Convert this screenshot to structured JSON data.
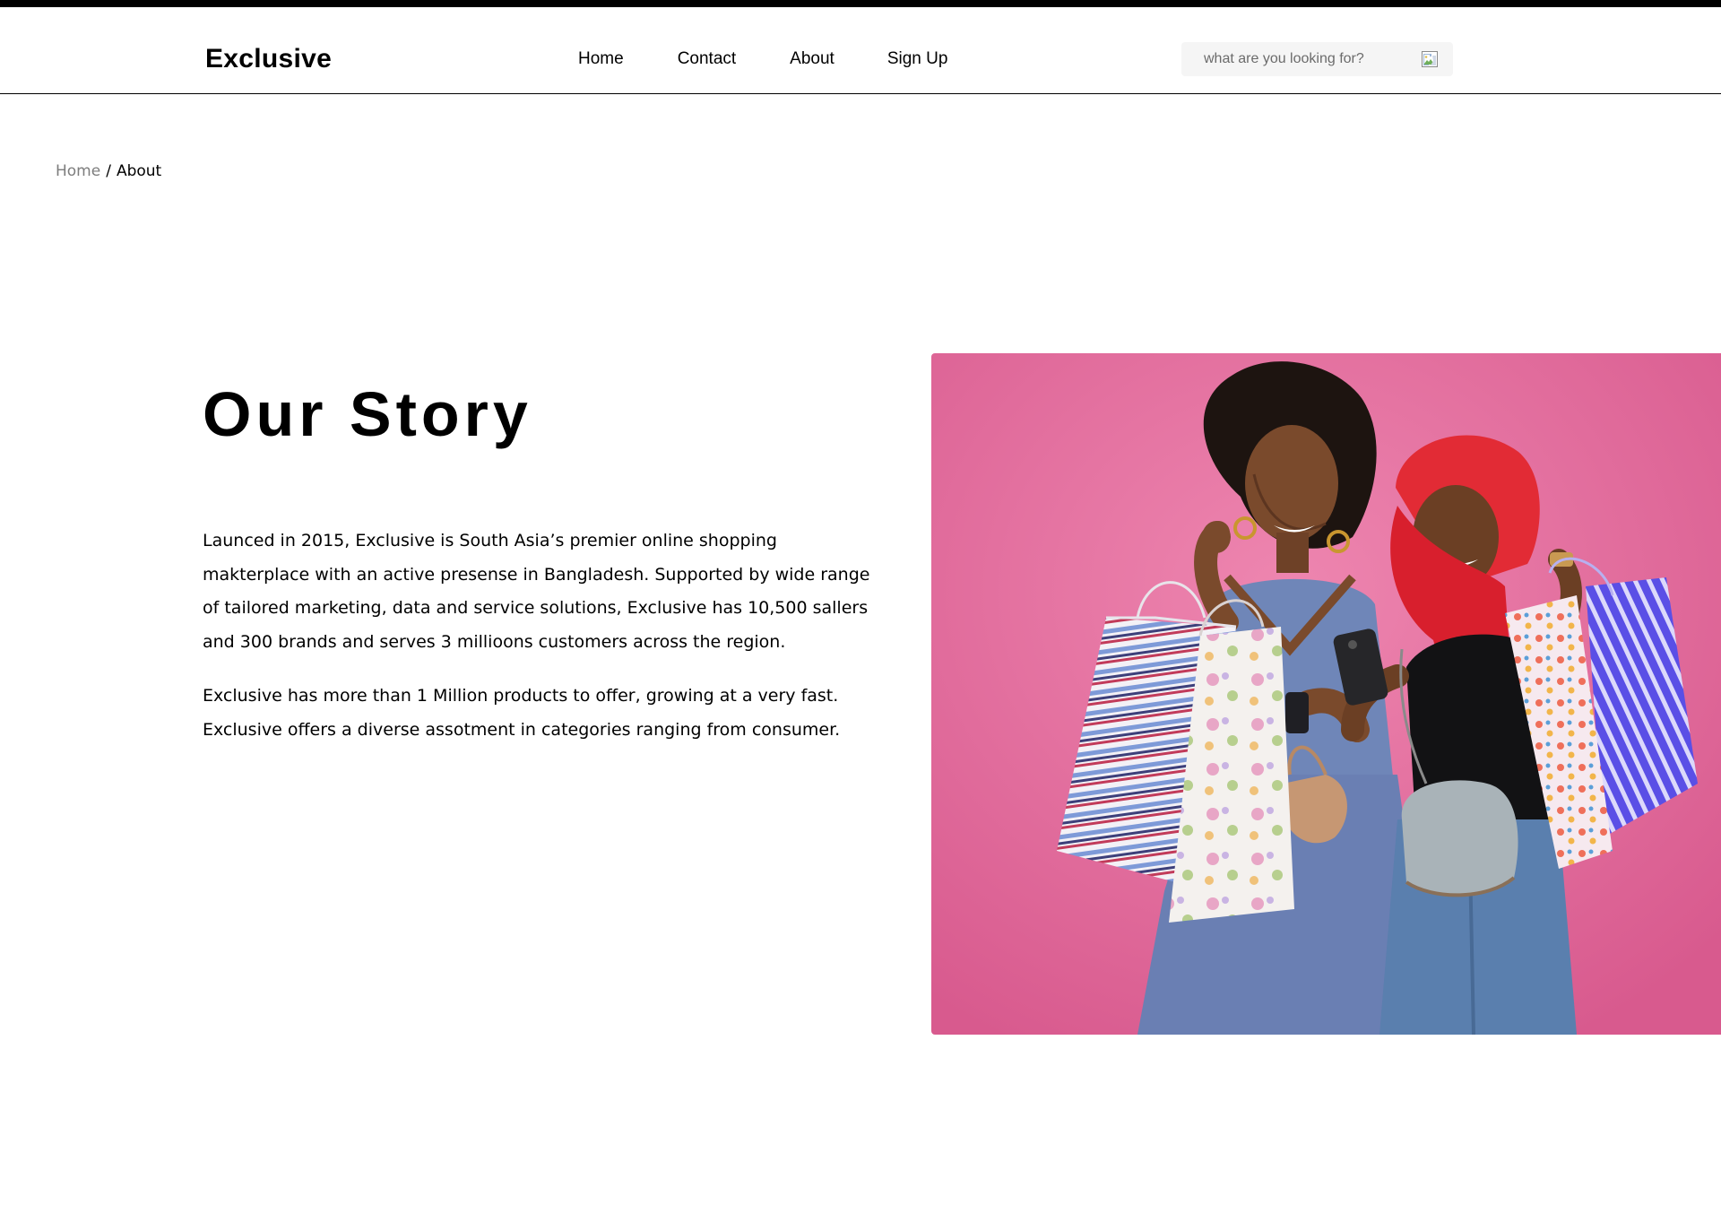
{
  "header": {
    "logo": "Exclusive",
    "nav": {
      "home": "Home",
      "contact": "Contact",
      "about": "About",
      "signup": "Sign Up"
    },
    "search": {
      "placeholder": "what are you looking for?",
      "value": "",
      "icon": "broken-image-icon"
    }
  },
  "breadcrumb": {
    "home": "Home",
    "separator": "/",
    "current": "About"
  },
  "story": {
    "title": "Our Story",
    "paragraph_1": "Launced in 2015, Exclusive is South Asia’s premier online shopping makterplace with an active presense in Bangladesh. Supported by wide range of tailored marketing, data and service solutions, Exclusive has 10,500 sallers and 300 brands and serves 3 millioons customers across the region.",
    "paragraph_2": "Exclusive has more than 1 Million products to offer, growing at a very fast. Exclusive offers a diverse assotment in categories ranging from consumer."
  },
  "colors": {
    "text": "#000000",
    "muted": "#7d7d7d",
    "search_bg": "#f5f5f5",
    "hero_bg": "#e06a9a"
  }
}
